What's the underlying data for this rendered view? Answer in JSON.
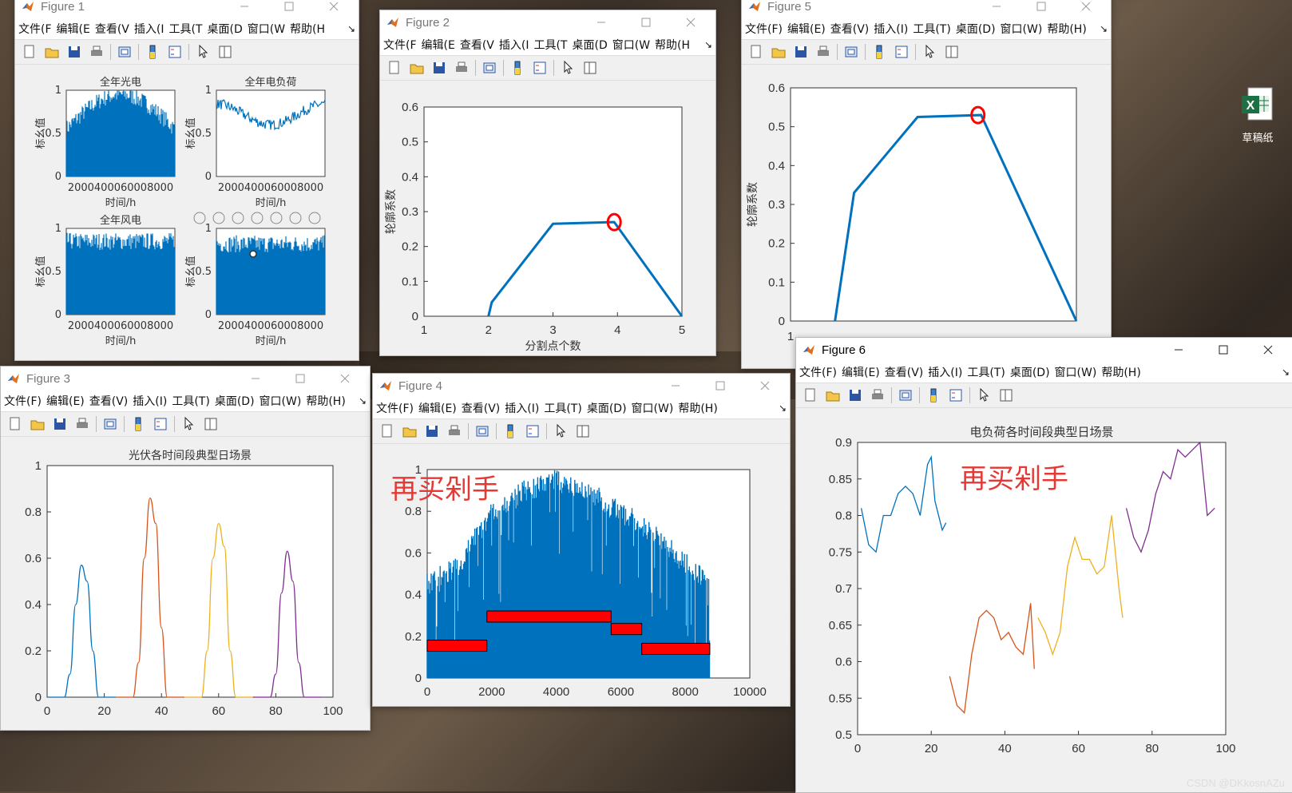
{
  "desktop": {
    "excel_icon_label": "草稿纸",
    "watermark": "CSDN @DKkosnAZu"
  },
  "menus_short": [
    "文件(F",
    "编辑(E",
    "查看(V",
    "插入(I",
    "工具(T",
    "桌面(D",
    "窗口(W",
    "帮助(H"
  ],
  "menus_full": [
    "文件(F)",
    "编辑(E)",
    "查看(V)",
    "插入(I)",
    "工具(T)",
    "桌面(D)",
    "窗口(W)",
    "帮助(H)"
  ],
  "figure1": {
    "title": "Figure 1",
    "subplots": [
      {
        "title": "全年光电",
        "ylabel": "标幺值",
        "xlabel": "时间/h",
        "xticks": "2000400060008000",
        "yticks": [
          "1",
          "0.5",
          "0"
        ]
      },
      {
        "title": "全年电负荷",
        "ylabel": "标幺值",
        "xlabel": "时间/h",
        "xticks": "2000400060008000",
        "yticks": [
          "1",
          "0.5",
          "0"
        ]
      },
      {
        "title": "全年风电",
        "ylabel": "标幺值",
        "xlabel": "时间/h",
        "xticks": "2000400060008000",
        "yticks": [
          "1",
          "0.5",
          "0"
        ]
      },
      {
        "title": "",
        "ylabel": "标幺值",
        "xlabel": "时间/h",
        "xticks": "2000400060008000",
        "yticks": [
          "1",
          "0.5",
          "0"
        ]
      }
    ]
  },
  "figure2": {
    "title": "Figure 2",
    "ylabel": "轮廓系数",
    "xlabel": "分割点个数"
  },
  "figure3": {
    "title": "Figure 3",
    "plot_title": "光伏各时间段典型日场景"
  },
  "figure4": {
    "title": "Figure 4",
    "overlay_text": "再买剁手"
  },
  "figure5": {
    "title": "Figure 5",
    "ylabel": "轮廓系数"
  },
  "figure6": {
    "title": "Figure 6",
    "plot_title": "电负荷各时间段典型日场景",
    "overlay_text": "再买剁手"
  },
  "chart_data": [
    {
      "id": "figure2",
      "type": "line",
      "x": [
        2,
        2.05,
        3,
        3.95,
        5
      ],
      "y": [
        0,
        0.04,
        0.265,
        0.27,
        0
      ],
      "xlim": [
        1,
        5
      ],
      "ylim": [
        0,
        0.6
      ],
      "xticks": [
        1,
        2,
        3,
        4,
        5
      ],
      "yticks": [
        0,
        0.1,
        0.2,
        0.3,
        0.4,
        0.5,
        0.6
      ],
      "marker": {
        "x": 3.95,
        "y": 0.27,
        "color": "#ff0000"
      },
      "xlabel": "分割点个数",
      "ylabel": "轮廓系数"
    },
    {
      "id": "figure5",
      "type": "line",
      "x": [
        1.7,
        2,
        3,
        4,
        5.5
      ],
      "y": [
        0,
        0.33,
        0.525,
        0.53,
        0
      ],
      "xlim": [
        1,
        5.5
      ],
      "ylim": [
        0,
        0.6
      ],
      "yticks": [
        0,
        0.1,
        0.2,
        0.3,
        0.4,
        0.5,
        0.6
      ],
      "marker": {
        "x": 3.95,
        "y": 0.53,
        "color": "#ff0000"
      },
      "ylabel": "轮廓系数"
    },
    {
      "id": "figure3",
      "type": "line",
      "title": "光伏各时间段典型日场景",
      "xlim": [
        0,
        100
      ],
      "ylim": [
        0,
        1
      ],
      "xticks": [
        0,
        20,
        40,
        60,
        80,
        100
      ],
      "yticks": [
        0,
        0.2,
        0.4,
        0.6,
        0.8,
        1
      ],
      "series": [
        {
          "color": "#0072bd",
          "x": [
            0,
            6,
            8,
            10,
            12,
            14,
            16,
            18,
            24
          ],
          "y": [
            0,
            0,
            0.1,
            0.4,
            0.57,
            0.5,
            0.2,
            0,
            0
          ]
        },
        {
          "color": "#d95319",
          "x": [
            24,
            30,
            32,
            34,
            36,
            38,
            40,
            42,
            48
          ],
          "y": [
            0,
            0,
            0.15,
            0.6,
            0.86,
            0.75,
            0.3,
            0,
            0
          ]
        },
        {
          "color": "#edb120",
          "x": [
            48,
            54,
            56,
            58,
            60,
            62,
            64,
            66,
            72
          ],
          "y": [
            0,
            0,
            0.2,
            0.6,
            0.75,
            0.65,
            0.2,
            0,
            0
          ]
        },
        {
          "color": "#7e2f8e",
          "x": [
            72,
            78,
            80,
            82,
            84,
            86,
            88,
            90,
            96
          ],
          "y": [
            0,
            0,
            0.1,
            0.45,
            0.63,
            0.5,
            0.15,
            0,
            0
          ]
        }
      ]
    },
    {
      "id": "figure4",
      "type": "bar",
      "xlim": [
        0,
        10000
      ],
      "ylim": [
        0,
        1
      ],
      "xticks": [
        0,
        2000,
        4000,
        6000,
        8000,
        10000
      ],
      "yticks": [
        0,
        0.2,
        0.4,
        0.6,
        0.8,
        1
      ],
      "envelope": {
        "x": [
          0,
          1000,
          2000,
          3000,
          4000,
          5000,
          6000,
          7000,
          8000,
          8760
        ],
        "y": [
          0.5,
          0.6,
          0.85,
          0.95,
          1.0,
          0.95,
          0.85,
          0.75,
          0.6,
          0.52
        ]
      },
      "segments": [
        {
          "x0": 0,
          "x1": 1850,
          "y": 0.155
        },
        {
          "x0": 1850,
          "x1": 5700,
          "y": 0.295
        },
        {
          "x0": 5700,
          "x1": 6650,
          "y": 0.235
        },
        {
          "x0": 6650,
          "x1": 8760,
          "y": 0.14
        }
      ]
    },
    {
      "id": "figure6",
      "type": "line",
      "title": "电负荷各时间段典型日场景",
      "xlim": [
        0,
        100
      ],
      "ylim": [
        0.5,
        0.9
      ],
      "xticks": [
        0,
        20,
        40,
        60,
        80,
        100
      ],
      "yticks": [
        0.5,
        0.55,
        0.6,
        0.65,
        0.7,
        0.75,
        0.8,
        0.85,
        0.9
      ],
      "series": [
        {
          "color": "#0072bd",
          "x": [
            1,
            3,
            5,
            7,
            9,
            11,
            13,
            15,
            17,
            19,
            20,
            21,
            23,
            24
          ],
          "y": [
            0.81,
            0.76,
            0.75,
            0.8,
            0.8,
            0.83,
            0.84,
            0.83,
            0.8,
            0.87,
            0.88,
            0.82,
            0.78,
            0.79
          ]
        },
        {
          "color": "#d95319",
          "x": [
            25,
            27,
            29,
            31,
            33,
            35,
            37,
            39,
            41,
            43,
            45,
            47,
            48
          ],
          "y": [
            0.58,
            0.54,
            0.53,
            0.61,
            0.66,
            0.67,
            0.66,
            0.63,
            0.64,
            0.62,
            0.61,
            0.68,
            0.59
          ]
        },
        {
          "color": "#edb120",
          "x": [
            49,
            51,
            53,
            55,
            57,
            59,
            61,
            63,
            65,
            67,
            69,
            71,
            72
          ],
          "y": [
            0.66,
            0.64,
            0.61,
            0.64,
            0.73,
            0.77,
            0.74,
            0.74,
            0.72,
            0.73,
            0.8,
            0.7,
            0.66
          ]
        },
        {
          "color": "#7e2f8e",
          "x": [
            73,
            75,
            77,
            79,
            81,
            83,
            85,
            87,
            89,
            91,
            93,
            95,
            97
          ],
          "y": [
            0.81,
            0.77,
            0.75,
            0.78,
            0.83,
            0.86,
            0.85,
            0.89,
            0.88,
            0.89,
            0.9,
            0.8,
            0.81
          ]
        }
      ]
    }
  ]
}
